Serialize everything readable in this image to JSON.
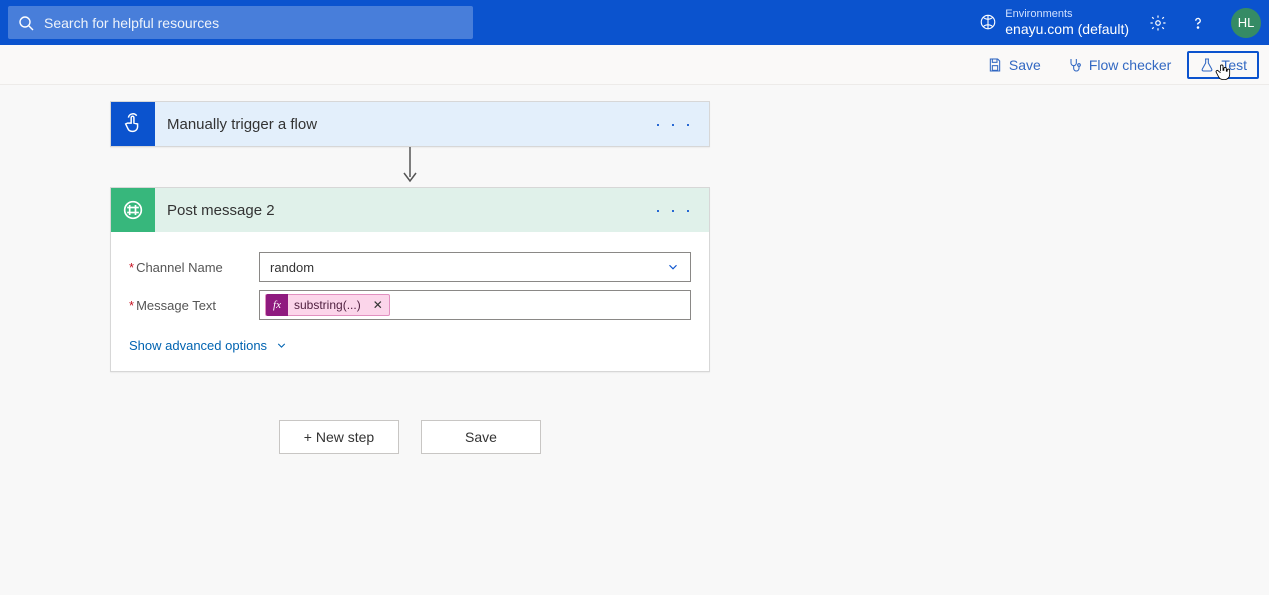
{
  "header": {
    "search_placeholder": "Search for helpful resources",
    "env_label": "Environments",
    "env_name": "enayu.com (default)",
    "avatar_initials": "HL"
  },
  "commands": {
    "save": "Save",
    "flow_checker": "Flow checker",
    "test": "Test"
  },
  "trigger": {
    "title": "Manually trigger a flow"
  },
  "action": {
    "title": "Post message 2",
    "fields": {
      "channel_label": "Channel Name",
      "channel_value": "random",
      "message_label": "Message Text",
      "fx_token": "substring(...)"
    },
    "advanced": "Show advanced options"
  },
  "bottom": {
    "new_step": "+ New step",
    "save": "Save"
  }
}
